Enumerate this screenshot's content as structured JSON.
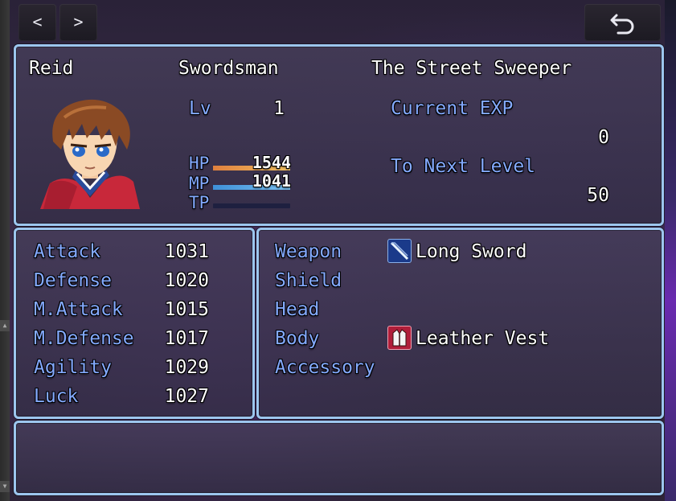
{
  "nav": {
    "prev_label": "<",
    "next_label": ">",
    "back_icon": "return-arrow-icon"
  },
  "actor": {
    "name": "Reid",
    "class": "Swordsman",
    "nickname": "The Street Sweeper",
    "level_label": "Lv",
    "level": "1",
    "hp_label": "HP",
    "hp": "1544",
    "hp_rate": 1.0,
    "mp_label": "MP",
    "mp": "1041",
    "mp_rate": 1.0,
    "tp_label": "TP",
    "tp_rate": 0.0,
    "exp_current_label": "Current EXP",
    "exp_current": "0",
    "exp_next_label": "To Next Level",
    "exp_next": "50"
  },
  "params": [
    {
      "label": "Attack",
      "value": "1031"
    },
    {
      "label": "Defense",
      "value": "1020"
    },
    {
      "label": "M.Attack",
      "value": "1015"
    },
    {
      "label": "M.Defense",
      "value": "1017"
    },
    {
      "label": "Agility",
      "value": "1029"
    },
    {
      "label": "Luck",
      "value": "1027"
    }
  ],
  "equips": [
    {
      "slot": "Weapon",
      "item": "Long Sword",
      "icon": "sword-icon"
    },
    {
      "slot": "Shield",
      "item": "",
      "icon": ""
    },
    {
      "slot": "Head",
      "item": "",
      "icon": ""
    },
    {
      "slot": "Body",
      "item": "Leather Vest",
      "icon": "vest-icon"
    },
    {
      "slot": "Accessory",
      "item": "",
      "icon": ""
    }
  ],
  "colors": {
    "window_border": "#9cc6ee",
    "system_text": "#84aaff",
    "normal_text": "#ffffff",
    "hp_gauge": "#e0803e",
    "mp_gauge": "#3e90d8",
    "tp_gauge": "#70e050"
  }
}
